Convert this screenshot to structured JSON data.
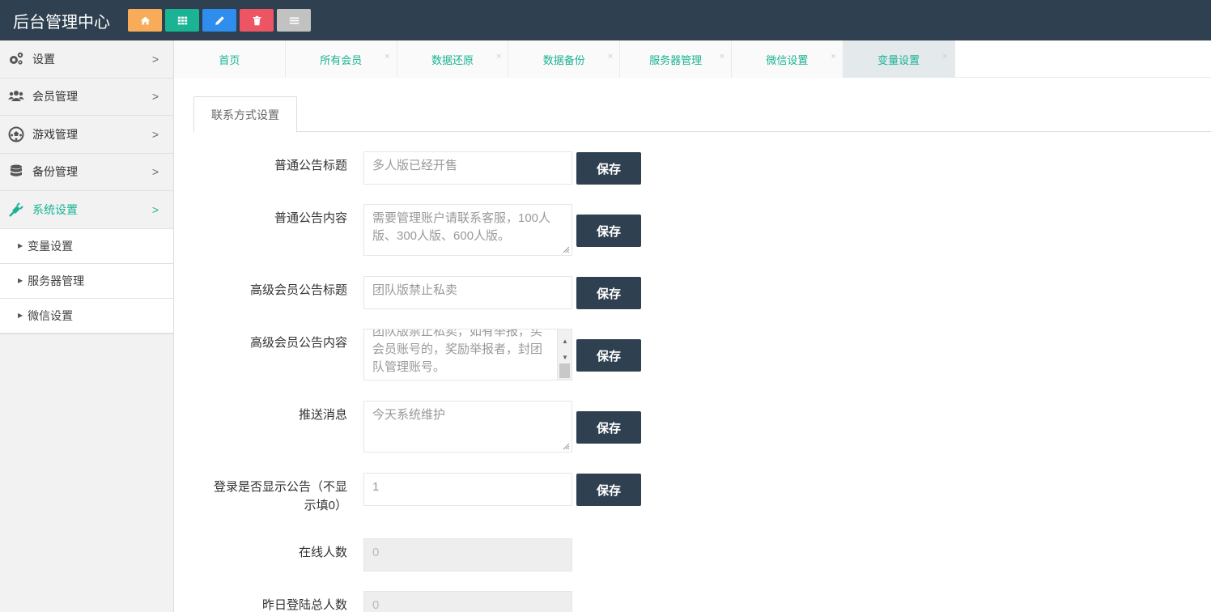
{
  "header": {
    "title": "后台管理中心",
    "buttons": [
      {
        "name": "home",
        "icon": "home-icon",
        "color": "#f8ac59"
      },
      {
        "name": "grid",
        "icon": "grid-icon",
        "color": "#1ab394"
      },
      {
        "name": "edit",
        "icon": "pencil-icon",
        "color": "#2e8ded"
      },
      {
        "name": "delete",
        "icon": "trash-icon",
        "color": "#ed5565"
      },
      {
        "name": "list",
        "icon": "list-icon",
        "color": "#c2c2c2"
      }
    ]
  },
  "sidebar": {
    "items": [
      {
        "label": "设置",
        "icon": "gears-icon"
      },
      {
        "label": "会员管理",
        "icon": "users-icon"
      },
      {
        "label": "游戏管理",
        "icon": "soccer-ball-icon"
      },
      {
        "label": "备份管理",
        "icon": "database-icon"
      },
      {
        "label": "系统设置",
        "icon": "plug-icon",
        "active": true
      }
    ],
    "sub_items": [
      {
        "label": "变量设置"
      },
      {
        "label": "服务器管理"
      },
      {
        "label": "微信设置"
      }
    ]
  },
  "tabs": [
    {
      "label": "首页",
      "closable": false
    },
    {
      "label": "所有会员",
      "closable": true
    },
    {
      "label": "数据还原",
      "closable": true
    },
    {
      "label": "数据备份",
      "closable": true
    },
    {
      "label": "服务器管理",
      "closable": true
    },
    {
      "label": "微信设置",
      "closable": true
    },
    {
      "label": "变量设置",
      "closable": true,
      "active": true
    }
  ],
  "close_glyph": "×",
  "chevron_glyph": ">",
  "content": {
    "subtab": "联系方式设置",
    "save_label": "保存",
    "fields": [
      {
        "label": "普通公告标题",
        "value": "多人版已经开售"
      },
      {
        "label": "普通公告内容",
        "value": "需要管理账户请联系客服，100人版、300人版、600人版。"
      },
      {
        "label": "高级会员公告标题",
        "value": "团队版禁止私卖"
      },
      {
        "label": "高级会员公告内容",
        "value": "团队版禁止私卖，如有举报，买会员账号的，奖励举报者，封团队管理账号。"
      },
      {
        "label": "推送消息",
        "value": "今天系统维护"
      },
      {
        "label_line1": "登录是否显示公告（不显",
        "label_line2": "示填0）",
        "value": "1"
      },
      {
        "label": "在线人数",
        "value": "0"
      },
      {
        "label": "昨日登陆总人数",
        "value": "0"
      }
    ]
  }
}
